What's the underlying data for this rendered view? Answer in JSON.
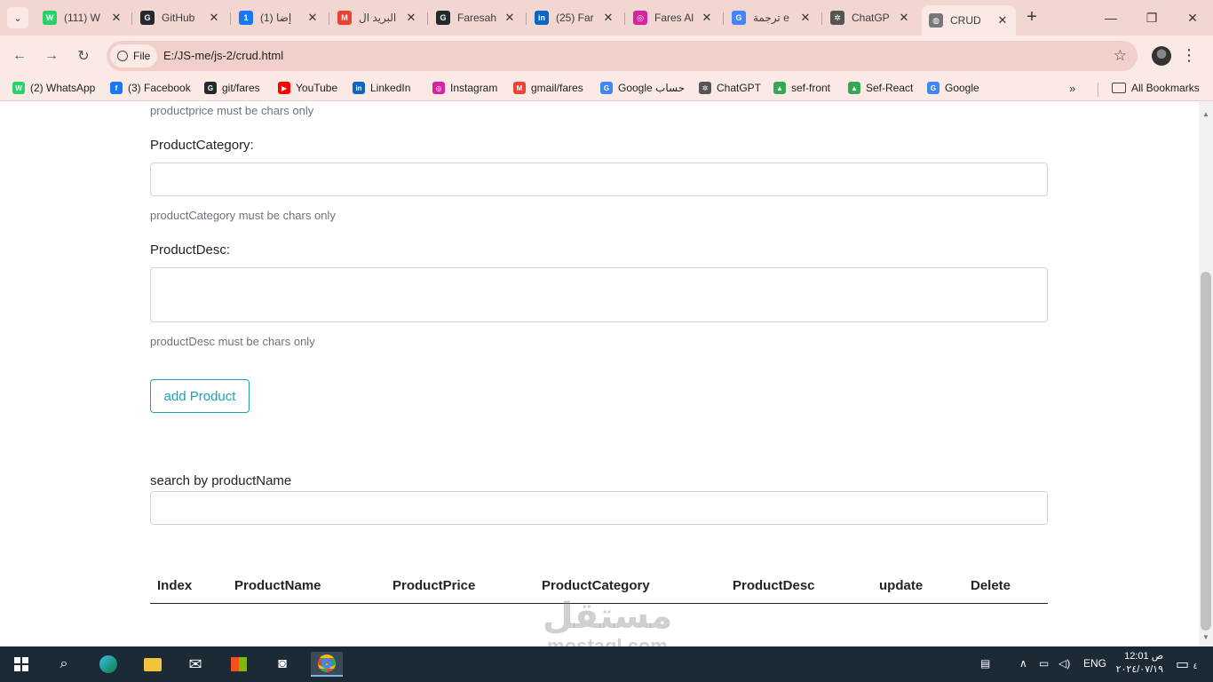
{
  "tabs": [
    {
      "title": "(111) W",
      "fav_color": "#25d366",
      "fav_glyph": "W",
      "icon": "whatsapp-icon"
    },
    {
      "title": "GitHub",
      "fav_color": "#24292f",
      "fav_glyph": "G",
      "icon": "github-icon"
    },
    {
      "title": "(1) إضا",
      "fav_color": "#1877f2",
      "fav_glyph": "1",
      "icon": "facebook-icon"
    },
    {
      "title": "البريد ال",
      "fav_color": "#ea4335",
      "fav_glyph": "M",
      "icon": "gmail-icon"
    },
    {
      "title": "Faresah",
      "fav_color": "#24292f",
      "fav_glyph": "G",
      "icon": "github-icon"
    },
    {
      "title": "(25) Far",
      "fav_color": "#0a66c2",
      "fav_glyph": "in",
      "icon": "linkedin-icon"
    },
    {
      "title": "Fares Al",
      "fav_color": "#d6249f",
      "fav_glyph": "◎",
      "icon": "instagram-icon"
    },
    {
      "title": "ترجمة e",
      "fav_color": "#4285f4",
      "fav_glyph": "G",
      "icon": "translate-icon"
    },
    {
      "title": "ChatGP",
      "fav_color": "#555555",
      "fav_glyph": "✲",
      "icon": "chatgpt-icon"
    },
    {
      "title": "CRUD",
      "fav_color": "#777777",
      "fav_glyph": "◍",
      "icon": "globe-icon"
    }
  ],
  "window_controls": {
    "minimize": "—",
    "maximize": "❐",
    "close": "✕"
  },
  "toolbar": {
    "back": "←",
    "forward": "→",
    "reload": "↻",
    "chip_label": "File",
    "url": "E:/JS-me/js-2/crud.html",
    "star": "☆",
    "menu": "⋮"
  },
  "bookmarks": [
    {
      "label": "(2) WhatsApp",
      "fav_color": "#25d366",
      "fav_glyph": "W",
      "icon": "whatsapp-icon"
    },
    {
      "label": "(3) Facebook",
      "fav_color": "#1877f2",
      "fav_glyph": "f",
      "icon": "facebook-icon"
    },
    {
      "label": "git/fares",
      "fav_color": "#24292f",
      "fav_glyph": "G",
      "icon": "github-icon"
    },
    {
      "label": "YouTube",
      "fav_color": "#ff0000",
      "fav_glyph": "▶",
      "icon": "youtube-icon"
    },
    {
      "label": "LinkedIn",
      "fav_color": "#0a66c2",
      "fav_glyph": "in",
      "icon": "linkedin-icon"
    },
    {
      "label": "Instagram",
      "fav_color": "#d6249f",
      "fav_glyph": "◎",
      "icon": "instagram-icon"
    },
    {
      "label": "gmail/fares",
      "fav_color": "#ea4335",
      "fav_glyph": "M",
      "icon": "gmail-icon"
    },
    {
      "label": "Google حساب",
      "fav_color": "#4285f4",
      "fav_glyph": "G",
      "icon": "google-icon"
    },
    {
      "label": "ChatGPT",
      "fav_color": "#555555",
      "fav_glyph": "✲",
      "icon": "chatgpt-icon"
    },
    {
      "label": "sef-front",
      "fav_color": "#34a853",
      "fav_glyph": "▲",
      "icon": "drive-icon"
    },
    {
      "label": "Sef-React",
      "fav_color": "#34a853",
      "fav_glyph": "▲",
      "icon": "drive-icon"
    },
    {
      "label": "Google",
      "fav_color": "#4285f4",
      "fav_glyph": "G",
      "icon": "google-icon"
    }
  ],
  "bookmarks_more": "»",
  "all_bookmarks": "All Bookmarks",
  "form": {
    "price_hint": "productprice must be chars only",
    "category_label": "ProductCategory:",
    "category_value": "",
    "category_hint": "productCategory must be chars only",
    "desc_label": "ProductDesc:",
    "desc_value": "",
    "desc_hint": "productDesc must be chars only",
    "add_button": "add Product",
    "search_label": "search by productName",
    "search_value": ""
  },
  "table": {
    "headers": [
      "Index",
      "ProductName",
      "ProductPrice",
      "ProductCategory",
      "ProductDesc",
      "update",
      "Delete"
    ]
  },
  "watermark": {
    "arabic": "مستقل",
    "latin": "mostaql.com"
  },
  "taskbar": {
    "language": "ENG",
    "time": "12:01 ص",
    "date": "٢٠٢٤/٠٧/١٩",
    "notification_count": "٤"
  }
}
